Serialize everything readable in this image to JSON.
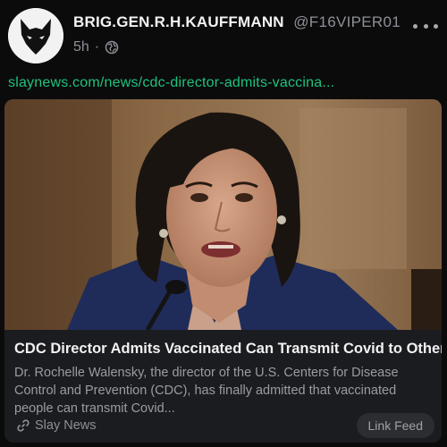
{
  "post": {
    "display_name": "BRIG.GEN.R.H.KAUFFMANN",
    "handle": "@F16VIPER01",
    "time": "5h",
    "separator": "·",
    "link_text": "slaynews.com/news/cdc-director-admits-vaccina..."
  },
  "icons": {
    "avatar": "wolf-avatar-icon",
    "privacy": "globe-icon",
    "more": "more-icon",
    "source": "link-icon"
  },
  "card": {
    "title": "CDC Director Admits Vaccinated Can Transmit Covid to Others",
    "description": "Dr. Rochelle Walensky, the director of the U.S. Centers for Disease Control and Prevention (CDC), has finally admitted that vaccinated people can transmit Covid...",
    "source": "Slay News",
    "feed_button": "Link Feed"
  },
  "colors": {
    "background": "#0b0b0c",
    "link": "#1fc27d",
    "card": "#1b1c1f"
  }
}
